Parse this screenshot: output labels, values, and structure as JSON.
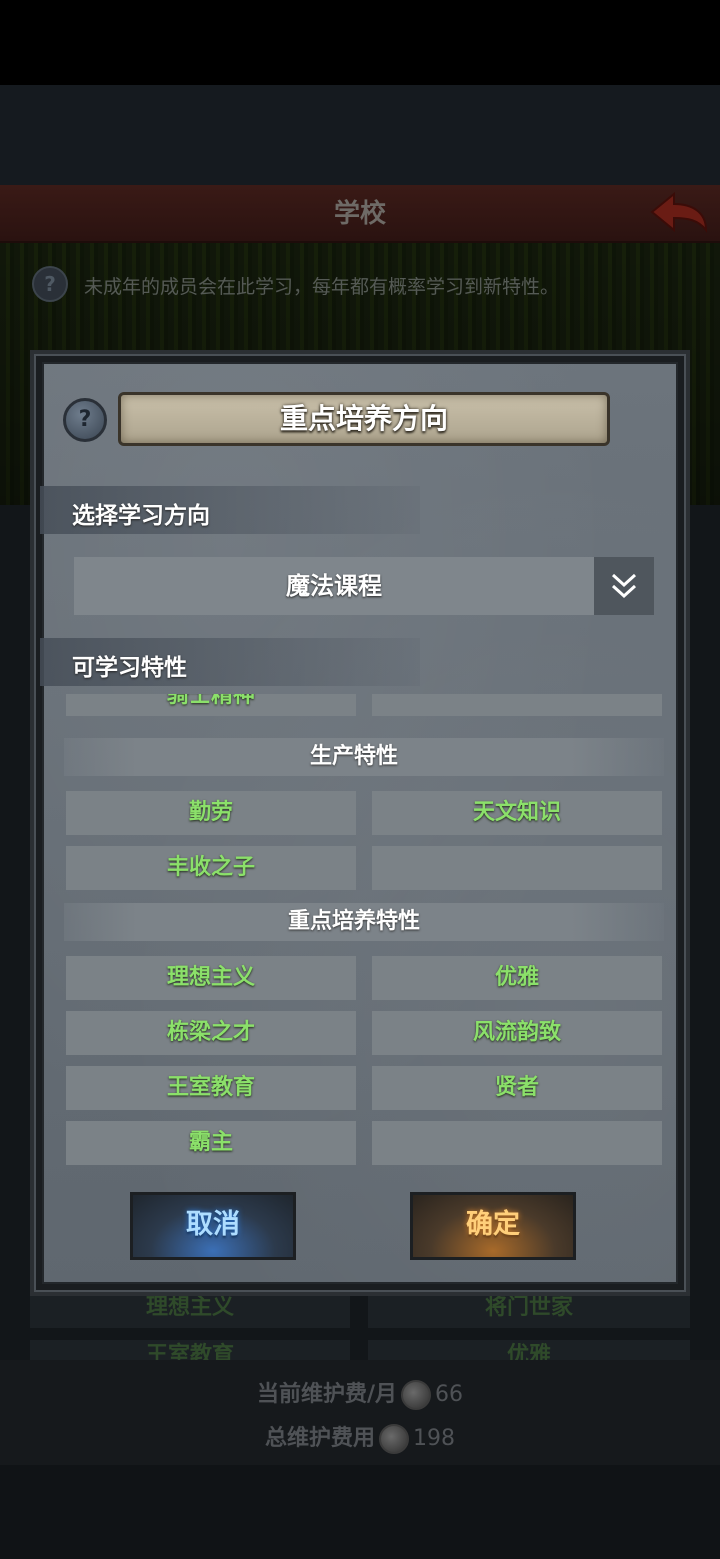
{
  "background": {
    "title": "学校",
    "description": "未成年的成员会在此学习，每年都有概率学习到新特性。",
    "help_icon": "?",
    "rows": [
      {
        "left": "理想主义",
        "right": "将门世家"
      },
      {
        "left": "王室教育",
        "right": "优雅"
      }
    ],
    "footer": {
      "monthly_label": "当前维护费/月",
      "monthly_value": "66",
      "total_label": "总维护费用",
      "total_value": "198"
    }
  },
  "modal": {
    "help_icon": "?",
    "title": "重点培养方向",
    "direction_label": "选择学习方向",
    "direction_value": "魔法课程",
    "traits_label": "可学习特性",
    "partial_trait": "骑士精神",
    "categories": [
      {
        "name": "生产特性",
        "traits": [
          "勤劳",
          "天文知识",
          "丰收之子",
          ""
        ]
      },
      {
        "name": "重点培养特性",
        "traits": [
          "理想主义",
          "优雅",
          "栋梁之才",
          "风流韵致",
          "王室教育",
          "贤者",
          "霸主",
          ""
        ]
      }
    ],
    "cancel_label": "取消",
    "confirm_label": "确定"
  },
  "colors": {
    "trait_text": "#8be06a",
    "cancel_glow": "#2f7bd8",
    "confirm_glow": "#d8862f"
  }
}
